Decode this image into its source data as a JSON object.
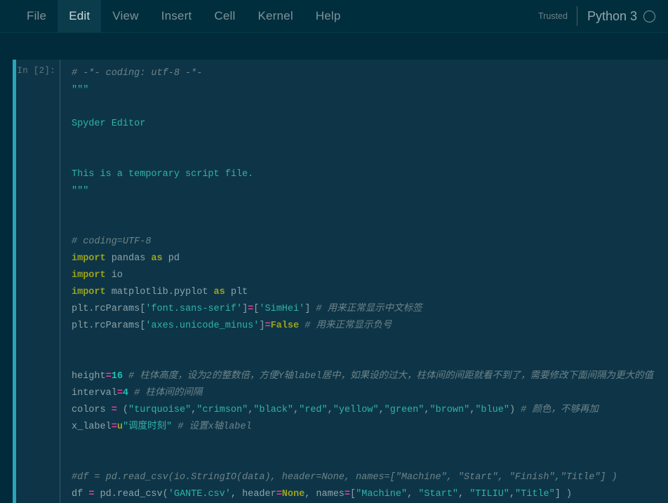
{
  "menubar": {
    "items": [
      {
        "label": "File",
        "active": false
      },
      {
        "label": "Edit",
        "active": true
      },
      {
        "label": "View",
        "active": false
      },
      {
        "label": "Insert",
        "active": false
      },
      {
        "label": "Cell",
        "active": false
      },
      {
        "label": "Kernel",
        "active": false
      },
      {
        "label": "Help",
        "active": false
      }
    ],
    "trusted_label": "Trusted",
    "kernel_name": "Python 3",
    "kernel_status_icon": "circle-idle-icon"
  },
  "cell": {
    "prompt": "In [2]:",
    "accent_color": "#27a4b8",
    "background_color": "#0d3547",
    "notebook_background_color": "#012b3a",
    "source_text": "# -*- coding: utf-8 -*-\n\"\"\"\n\nSpyder Editor\n\n\nThis is a temporary script file.\n\"\"\"\n\n\n# coding=UTF-8\nimport pandas as pd\nimport io\nimport matplotlib.pyplot as plt\nplt.rcParams['font.sans-serif']=['SimHei'] # 用来正常显示中文标签\nplt.rcParams['axes.unicode_minus']=False # 用来正常显示负号\n\n\nheight=16 # 柱体高度，设为2的整数倍，方便Y轴label居中，如果设的过大，柱体间的间距就看不到了，需要修改下面间隔为更大的值\ninterval=4 # 柱体间的间隔\ncolors = (\"turquoise\",\"crimson\",\"black\",\"red\",\"yellow\",\"green\",\"brown\",\"blue\") # 颜色，不够再加\nx_label=u\"调度时刻\" # 设置x轴label\n\n\n#df = pd.read_csv(io.StringIO(data), header=None, names=[\"Machine\", \"Start\", \"Finish\",\"Title\"] )\ndf = pd.read_csv('GANTE.csv', header=None, names=[\"Machine\", \"Start\", \"TILIU\",\"Title\"] )",
    "lines": [
      {
        "id": 1,
        "tokens": [
          {
            "c": "t-comment",
            "s": "# -*- coding: utf-8 -*-"
          }
        ]
      },
      {
        "id": 2,
        "tokens": [
          {
            "c": "t-doc",
            "s": "\"\"\""
          }
        ]
      },
      {
        "id": 3,
        "tokens": []
      },
      {
        "id": 4,
        "tokens": [
          {
            "c": "t-doc",
            "s": "Spyder Editor"
          }
        ]
      },
      {
        "id": 5,
        "tokens": []
      },
      {
        "id": 6,
        "tokens": []
      },
      {
        "id": 7,
        "tokens": [
          {
            "c": "t-doc",
            "s": "This is a temporary script file."
          }
        ]
      },
      {
        "id": 8,
        "tokens": [
          {
            "c": "t-doc",
            "s": "\"\"\""
          }
        ]
      },
      {
        "id": 9,
        "tokens": []
      },
      {
        "id": 10,
        "tokens": []
      },
      {
        "id": 11,
        "tokens": [
          {
            "c": "t-comment",
            "s": "# coding=UTF-8"
          }
        ]
      },
      {
        "id": 12,
        "tokens": [
          {
            "c": "t-kw",
            "s": "import"
          },
          {
            "c": "t-plain",
            "s": " pandas "
          },
          {
            "c": "t-kw",
            "s": "as"
          },
          {
            "c": "t-plain",
            "s": " pd"
          }
        ]
      },
      {
        "id": 13,
        "tokens": [
          {
            "c": "t-kw",
            "s": "import"
          },
          {
            "c": "t-plain",
            "s": " io"
          }
        ]
      },
      {
        "id": 14,
        "tokens": [
          {
            "c": "t-kw",
            "s": "import"
          },
          {
            "c": "t-plain",
            "s": " matplotlib.pyplot "
          },
          {
            "c": "t-kw",
            "s": "as"
          },
          {
            "c": "t-plain",
            "s": " plt"
          }
        ]
      },
      {
        "id": 15,
        "tokens": [
          {
            "c": "t-plain",
            "s": "plt.rcParams["
          },
          {
            "c": "t-string",
            "s": "'font.sans-serif'"
          },
          {
            "c": "t-plain",
            "s": "]"
          },
          {
            "c": "t-op",
            "s": "="
          },
          {
            "c": "t-plain",
            "s": "["
          },
          {
            "c": "t-string",
            "s": "'SimHei'"
          },
          {
            "c": "t-plain",
            "s": "] "
          },
          {
            "c": "t-comment",
            "s": "# 用来正常显示中文标签"
          }
        ]
      },
      {
        "id": 16,
        "tokens": [
          {
            "c": "t-plain",
            "s": "plt.rcParams["
          },
          {
            "c": "t-string",
            "s": "'axes.unicode_minus'"
          },
          {
            "c": "t-plain",
            "s": "]"
          },
          {
            "c": "t-op",
            "s": "="
          },
          {
            "c": "t-builtin",
            "s": "False"
          },
          {
            "c": "t-plain",
            "s": " "
          },
          {
            "c": "t-comment",
            "s": "# 用来正常显示负号"
          }
        ]
      },
      {
        "id": 17,
        "tokens": []
      },
      {
        "id": 18,
        "tokens": []
      },
      {
        "id": 19,
        "tokens": [
          {
            "c": "t-plain",
            "s": "height"
          },
          {
            "c": "t-op",
            "s": "="
          },
          {
            "c": "t-num",
            "s": "16"
          },
          {
            "c": "t-plain",
            "s": " "
          },
          {
            "c": "t-comment",
            "s": "# 柱体高度，设为2的整数倍，方便Y轴label居中，如果设的过大，柱体间的间距就看不到了，需要修改下面间隔为更大的值"
          }
        ]
      },
      {
        "id": 20,
        "tokens": [
          {
            "c": "t-plain",
            "s": "interval"
          },
          {
            "c": "t-op",
            "s": "="
          },
          {
            "c": "t-num",
            "s": "4"
          },
          {
            "c": "t-plain",
            "s": " "
          },
          {
            "c": "t-comment",
            "s": "# 柱体间的间隔"
          }
        ]
      },
      {
        "id": 21,
        "tokens": [
          {
            "c": "t-plain",
            "s": "colors "
          },
          {
            "c": "t-op",
            "s": "="
          },
          {
            "c": "t-plain",
            "s": " ("
          },
          {
            "c": "t-string",
            "s": "\"turquoise\""
          },
          {
            "c": "t-plain",
            "s": ","
          },
          {
            "c": "t-string",
            "s": "\"crimson\""
          },
          {
            "c": "t-plain",
            "s": ","
          },
          {
            "c": "t-string",
            "s": "\"black\""
          },
          {
            "c": "t-plain",
            "s": ","
          },
          {
            "c": "t-string",
            "s": "\"red\""
          },
          {
            "c": "t-plain",
            "s": ","
          },
          {
            "c": "t-string",
            "s": "\"yellow\""
          },
          {
            "c": "t-plain",
            "s": ","
          },
          {
            "c": "t-string",
            "s": "\"green\""
          },
          {
            "c": "t-plain",
            "s": ","
          },
          {
            "c": "t-string",
            "s": "\"brown\""
          },
          {
            "c": "t-plain",
            "s": ","
          },
          {
            "c": "t-string",
            "s": "\"blue\""
          },
          {
            "c": "t-plain",
            "s": ") "
          },
          {
            "c": "t-comment",
            "s": "# 颜色，不够再加"
          }
        ]
      },
      {
        "id": 22,
        "tokens": [
          {
            "c": "t-plain",
            "s": "x_label"
          },
          {
            "c": "t-op",
            "s": "="
          },
          {
            "c": "t-builtin",
            "s": "u"
          },
          {
            "c": "t-string",
            "s": "\"调度时刻\""
          },
          {
            "c": "t-plain",
            "s": " "
          },
          {
            "c": "t-comment",
            "s": "# 设置x轴label"
          }
        ]
      },
      {
        "id": 23,
        "tokens": []
      },
      {
        "id": 24,
        "tokens": []
      },
      {
        "id": 25,
        "tokens": [
          {
            "c": "t-comment",
            "s": "#df = pd.read_csv(io.StringIO(data), header=None, names=[\"Machine\", \"Start\", \"Finish\",\"Title\"] )"
          }
        ]
      },
      {
        "id": 26,
        "tokens": [
          {
            "c": "t-plain",
            "s": "df "
          },
          {
            "c": "t-op",
            "s": "="
          },
          {
            "c": "t-plain",
            "s": " pd.read_csv("
          },
          {
            "c": "t-string",
            "s": "'GANTE.csv'"
          },
          {
            "c": "t-plain",
            "s": ", header"
          },
          {
            "c": "t-op",
            "s": "="
          },
          {
            "c": "t-builtin",
            "s": "None"
          },
          {
            "c": "t-plain",
            "s": ", names"
          },
          {
            "c": "t-op",
            "s": "="
          },
          {
            "c": "t-plain",
            "s": "["
          },
          {
            "c": "t-string",
            "s": "\"Machine\""
          },
          {
            "c": "t-plain",
            "s": ", "
          },
          {
            "c": "t-string",
            "s": "\"Start\""
          },
          {
            "c": "t-plain",
            "s": ", "
          },
          {
            "c": "t-string",
            "s": "\"TILIU\""
          },
          {
            "c": "t-plain",
            "s": ","
          },
          {
            "c": "t-string",
            "s": "\"Title\""
          },
          {
            "c": "t-plain",
            "s": "] )"
          }
        ]
      }
    ]
  }
}
